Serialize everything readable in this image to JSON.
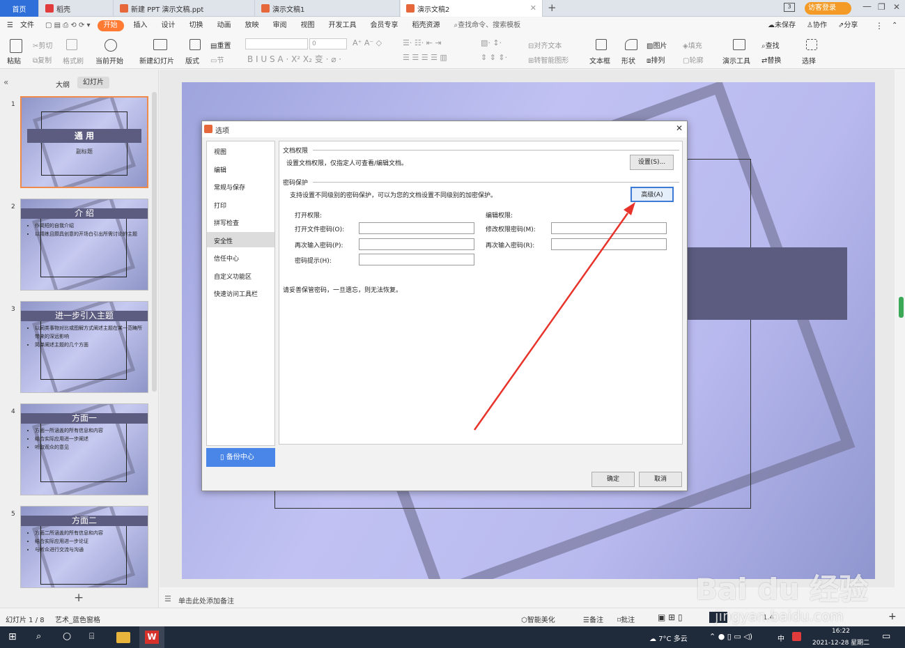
{
  "tabs": [
    {
      "label": "首页"
    },
    {
      "label": "稻壳"
    },
    {
      "label": "新建 PPT 演示文稿.ppt"
    },
    {
      "label": "演示文稿1"
    },
    {
      "label": "演示文稿2"
    }
  ],
  "window_right": {
    "label": "访客登录"
  },
  "menu": {
    "file": "文件",
    "items": [
      "开始",
      "插入",
      "设计",
      "切换",
      "动画",
      "放映",
      "审阅",
      "视图",
      "开发工具",
      "会员专享",
      "稻壳资源"
    ],
    "search": "查找命令、搜索模板",
    "unsaved": "未保存",
    "collab": "协作",
    "share": "分享"
  },
  "toolbar": {
    "paste": "粘贴",
    "cut": "剪切",
    "copy": "复制",
    "format": "格式刷",
    "from_current": "当前开始",
    "new_slide": "新建幻灯片",
    "layout": "版式",
    "reset": "重置",
    "section": "节",
    "font_size": "0",
    "align_text": "对齐文本",
    "smartart": "转智能图形",
    "textbox": "文本框",
    "shape": "形状",
    "picture": "图片",
    "fill": "填充",
    "arrange": "排列",
    "outline": "轮廓",
    "present_tools": "演示工具",
    "find": "查找",
    "replace": "替换",
    "select": "选择"
  },
  "panel": {
    "outline_tab": "大纲",
    "slides_tab": "幻灯片"
  },
  "slides": [
    {
      "num": "1",
      "title": "通 用",
      "subtitle": "副标题",
      "bullets": []
    },
    {
      "num": "2",
      "title": "介 绍",
      "bullets": [
        "作简短的自我介绍",
        "以精练且颇具创意的开场白引出所需讨论的主题"
      ]
    },
    {
      "num": "3",
      "title": "进一步引入主题",
      "bullets": [
        "以同类事物对比或图解方式阐述主题在某一范畴所带来的深远影响",
        "简单阐述主题的几个方面"
      ]
    },
    {
      "num": "4",
      "title": "方面一",
      "bullets": [
        "方面一所涵盖的所有信息和内容",
        "结合实际应用进一步阐述",
        "听取观众的意见"
      ]
    },
    {
      "num": "5",
      "title": "方面二",
      "bullets": [
        "方面二所涵盖的所有信息和内容",
        "结合实际应用进一步论证",
        "与听众进行交流与沟通"
      ]
    }
  ],
  "dialog": {
    "title": "选项",
    "nav": [
      "视图",
      "编辑",
      "常规与保存",
      "打印",
      "拼写检查",
      "安全性",
      "信任中心",
      "自定义功能区",
      "快速访问工具栏"
    ],
    "nav_selected": "安全性",
    "backup": "备份中心",
    "doc_perm_heading": "文档权限",
    "doc_perm_desc": "设置文档权限，仅指定人可查看/编辑文档。",
    "settings_btn": "设置(S)...",
    "pwd_heading": "密码保护",
    "pwd_desc": "支持设置不同级别的密码保护，可以为您的文档设置不同级别的加密保护。",
    "advanced_btn": "高级(A)",
    "open_perm": "打开权限:",
    "edit_perm": "编辑权限:",
    "open_pwd": "打开文件密码(O):",
    "open_pwd_re": "再次输入密码(P):",
    "pwd_hint": "密码提示(H):",
    "edit_pwd": "修改权限密码(M):",
    "edit_pwd_re": "再次输入密码(R):",
    "warning": "请妥善保管密码，一旦遗忘，则无法恢复。",
    "ok": "确定",
    "cancel": "取消"
  },
  "notes": "单击此处添加备注",
  "status": {
    "slide": "幻灯片 1 / 8",
    "theme": "艺术_蓝色窗格",
    "beautify": "智能美化",
    "notes": "备注",
    "comment": "批注",
    "zoom": "1.4"
  },
  "taskbar": {
    "weather": "7°C 多云",
    "ime": "中",
    "time": "16:22",
    "date": "2021-12-28 星期二"
  },
  "watermark": {
    "brand": "Bai du 经验",
    "url": "jingyan.baidu.com"
  },
  "colors": {
    "accent": "#ff7a33",
    "home_tab": "#2f6fd9",
    "arrow": "#e8332a",
    "slide_band": "#5c5c80"
  }
}
